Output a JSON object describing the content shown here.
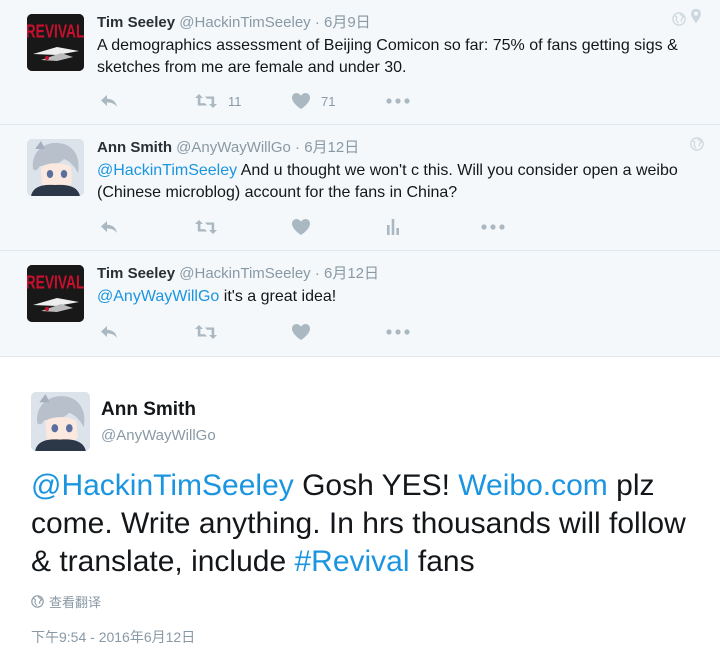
{
  "tweets": [
    {
      "name": "Tim Seeley",
      "handle": "@HackinTimSeeley",
      "date": "· 6月9日",
      "text": "A demographics assessment of Beijing Comicon so far: 75% of fans getting sigs & sketches from me are female and under 30.",
      "retweets": "11",
      "likes": "71",
      "avatar_text": "REVIVAL"
    },
    {
      "name": "Ann Smith",
      "handle": "@AnyWayWillGo",
      "date": "· 6月12日",
      "mention": "@HackinTimSeeley",
      "text": " And u thought we won't c this. Will you consider open a weibo (Chinese microblog) account for the fans in China?"
    },
    {
      "name": "Tim Seeley",
      "handle": "@HackinTimSeeley",
      "date": "· 6月12日",
      "mention": "@AnyWayWillGo",
      "text": " it's a great idea!",
      "avatar_text": "REVIVAL"
    }
  ],
  "main_tweet": {
    "name": "Ann Smith",
    "handle": "@AnyWayWillGo",
    "mention": "@HackinTimSeeley",
    "text_1": " Gosh YES! ",
    "link": "Weibo.com",
    "text_2": " plz come. Write anything. In hrs thousands will follow & translate, include ",
    "hashtag": "#Revival",
    "text_3": " fans",
    "translate_label": "查看翻译",
    "timestamp": "下午9:54 - 2016年6月12日"
  },
  "colors": {
    "link": "#1b95e0",
    "icon": "#aab8c2",
    "meta": "#8899a6",
    "convo_bg": "#f5f8fa"
  },
  "icons": [
    "reply-icon",
    "retweet-icon",
    "like-icon",
    "analytics-icon",
    "more-icon",
    "globe-icon",
    "location-pin-icon"
  ]
}
